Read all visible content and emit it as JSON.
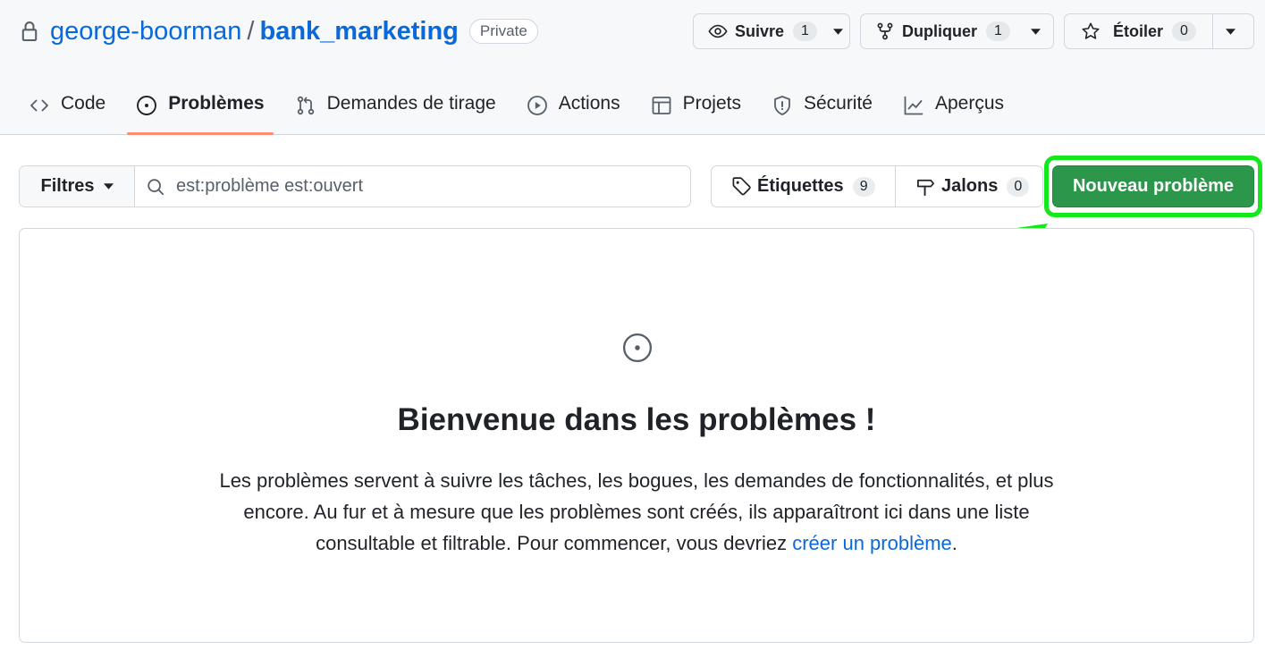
{
  "repo": {
    "owner": "george-boorman",
    "separator": "/",
    "name": "bank_marketing",
    "visibility": "Private"
  },
  "header_actions": {
    "watch": {
      "label": "Suivre",
      "count": "1",
      "icon": "eye-icon"
    },
    "fork": {
      "label": "Dupliquer",
      "count": "1",
      "icon": "repo-forked-icon"
    },
    "star": {
      "label": "Étoiler",
      "count": "0",
      "icon": "star-icon"
    }
  },
  "tabs": [
    {
      "label": "Code",
      "icon": "code-icon",
      "active": false
    },
    {
      "label": "Problèmes",
      "icon": "issue-opened-icon",
      "active": true
    },
    {
      "label": "Demandes de tirage",
      "icon": "git-pull-request-icon",
      "active": false
    },
    {
      "label": "Actions",
      "icon": "play-icon",
      "active": false
    },
    {
      "label": "Projets",
      "icon": "table-icon",
      "active": false
    },
    {
      "label": "Sécurité",
      "icon": "shield-icon",
      "active": false
    },
    {
      "label": "Aperçus",
      "icon": "graph-icon",
      "active": false
    }
  ],
  "toolbar": {
    "filters_label": "Filtres",
    "search_value": "est:problème est:ouvert",
    "labels": {
      "label": "Étiquettes",
      "count": "9"
    },
    "milestones": {
      "label": "Jalons",
      "count": "0"
    },
    "new_issue_label": "Nouveau problème"
  },
  "blankslate": {
    "title": "Bienvenue dans les problèmes !",
    "body": "Les problèmes servent à suivre les tâches, les bogues, les demandes de fonctionnalités, et plus encore. Au fur et à mesure que les problèmes sont créés, ils apparaîtront ici dans une liste consultable et filtrable. Pour commencer, vous devriez ",
    "link": "créer un problème",
    "end": "."
  },
  "colors": {
    "accent_link": "#0969da",
    "primary_button": "#2c974b",
    "highlight": "#12e81a",
    "active_tab_underline": "#fd8c73"
  }
}
